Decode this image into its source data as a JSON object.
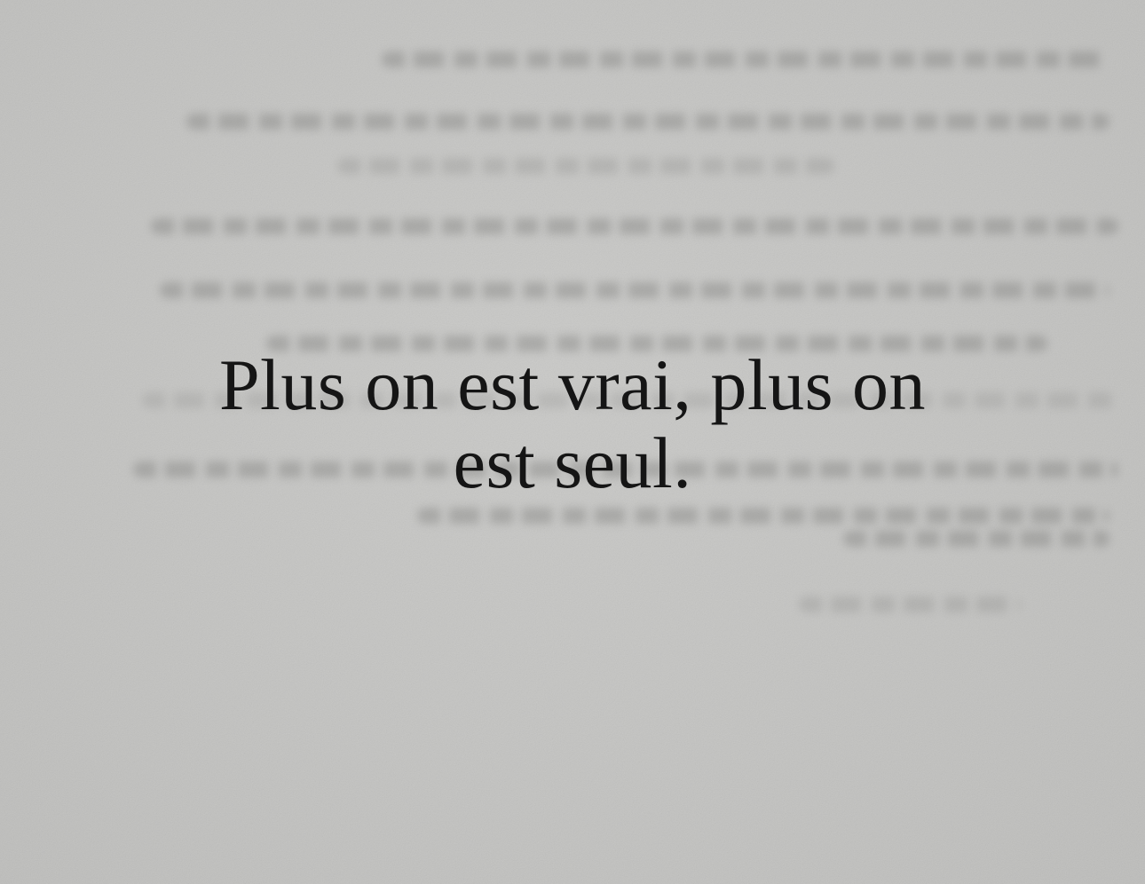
{
  "background": {
    "paper_color": "#c4c4c2",
    "ghost_text_color": "#7a7a78"
  },
  "quote": {
    "line1": "Plus on est vrai, plus on",
    "line2": "est seul.",
    "color": "#151515"
  }
}
